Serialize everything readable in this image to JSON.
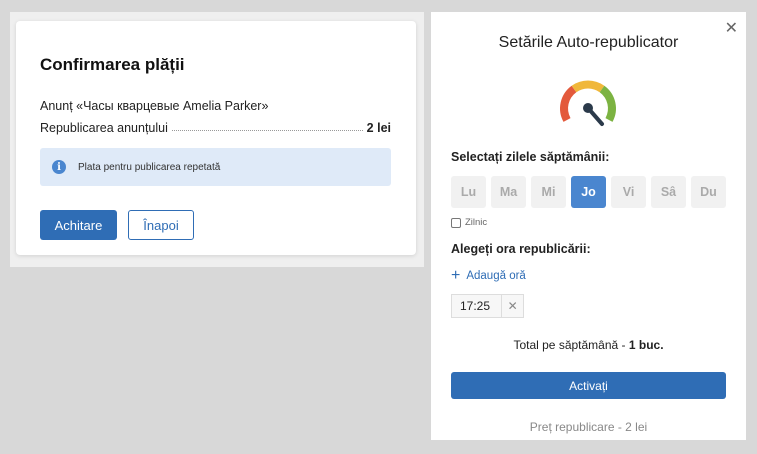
{
  "payment": {
    "title": "Confirmarea plății",
    "ad_line": "Anunț «Часы кварцевые Amelia Parker»",
    "service_label": "Republicarea anunțului",
    "service_price": "2 lei",
    "info_text": "Plata pentru publicarea repetată",
    "pay_button": "Achitare",
    "back_button": "Înapoi"
  },
  "autorepublish": {
    "title": "Setările Auto-republicator",
    "close_symbol": "✕",
    "days_label": "Selectați zilele săptămânii:",
    "days": [
      {
        "label": "Lu",
        "selected": false
      },
      {
        "label": "Ma",
        "selected": false
      },
      {
        "label": "Mi",
        "selected": false
      },
      {
        "label": "Jo",
        "selected": true
      },
      {
        "label": "Vi",
        "selected": false
      },
      {
        "label": "Sâ",
        "selected": false
      },
      {
        "label": "Du",
        "selected": false
      }
    ],
    "daily_label": "Zilnic",
    "daily_checked": false,
    "time_label": "Alegeți ora republicării:",
    "add_time_label": "Adaugă oră",
    "times": [
      "17:25"
    ],
    "total_prefix": "Total pe săptămână - ",
    "total_value": "1 buc.",
    "activate_button": "Activați",
    "footer_price": "Preț republicare - 2 lei",
    "gauge_colors": {
      "red": "#e35a3c",
      "yellow": "#f0b73a",
      "green": "#7cb342",
      "needle": "#2b3a4a"
    }
  },
  "colors": {
    "accent": "#2f6db5",
    "active_day": "#4a86cf",
    "info_bg": "#dfeaf8"
  }
}
